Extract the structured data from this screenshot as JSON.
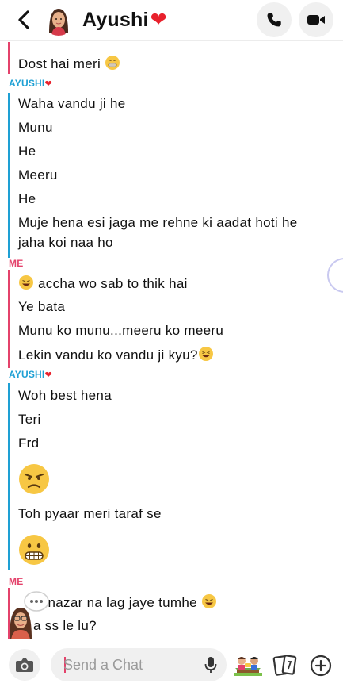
{
  "header": {
    "name": "Ayushi",
    "name_emoji": "❤",
    "back_icon": "chevron-left-icon",
    "call_icon": "phone-icon",
    "video_icon": "video-camera-icon"
  },
  "chat": {
    "messages": [
      {
        "text": "Dost hai meri"
      },
      {
        "sender": "AYUSHI",
        "heart": "❤"
      },
      {
        "text": "Waha vandu ji he"
      },
      {
        "text": "Munu"
      },
      {
        "text": "He"
      },
      {
        "text": "Meeru"
      },
      {
        "text": "He"
      },
      {
        "text": "Muje hena esi jaga me rehne ki aadat hoti he"
      },
      {
        "text": "jaha koi naa ho"
      },
      {
        "sender": "ME"
      },
      {
        "text": "accha wo sab to thik hai"
      },
      {
        "text": "Ye bata"
      },
      {
        "text": "Munu ko munu...meeru ko meeru"
      },
      {
        "text": "Lekin vandu ko vandu ji kyu?"
      },
      {
        "sender": "AYUSHI",
        "heart": "❤"
      },
      {
        "text": "Woh best hena"
      },
      {
        "text": "Teri"
      },
      {
        "text": "Frd"
      },
      {
        "text": "Toh pyaar meri taraf se"
      },
      {
        "sender": "ME"
      },
      {
        "text": "ee nazar na lag jaye tumhe"
      },
      {
        "text": "a ss le lu?"
      }
    ]
  },
  "composer": {
    "placeholder": "Send a Chat",
    "camera_icon": "camera-icon",
    "mic_icon": "microphone-icon",
    "bitmoji_icon": "bitmoji-icon",
    "cards_icon": "cards-icon",
    "plus_icon": "plus-circle-icon"
  },
  "colors": {
    "me": "#e4426b",
    "friend": "#1ea0d4",
    "heart": "#e8212c"
  }
}
